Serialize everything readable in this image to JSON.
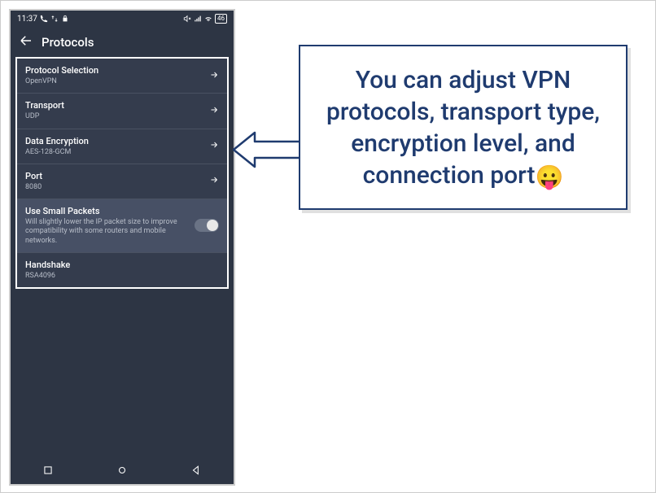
{
  "statusbar": {
    "time": "11:37",
    "battery": "46"
  },
  "appbar": {
    "title": "Protocols"
  },
  "rows": {
    "protocol": {
      "label": "Protocol Selection",
      "value": "OpenVPN"
    },
    "transport": {
      "label": "Transport",
      "value": "UDP"
    },
    "encryption": {
      "label": "Data Encryption",
      "value": "AES-128-GCM"
    },
    "port": {
      "label": "Port",
      "value": "8080"
    },
    "smallpackets": {
      "label": "Use Small Packets",
      "desc": "Will slightly lower the IP packet size to improve compatibility with some routers and mobile networks."
    },
    "handshake": {
      "label": "Handshake",
      "value": "RSA4096"
    }
  },
  "callout": {
    "text": "You can adjust VPN protocols, transport type, encryption level, and connection port",
    "emoji": "😛"
  }
}
